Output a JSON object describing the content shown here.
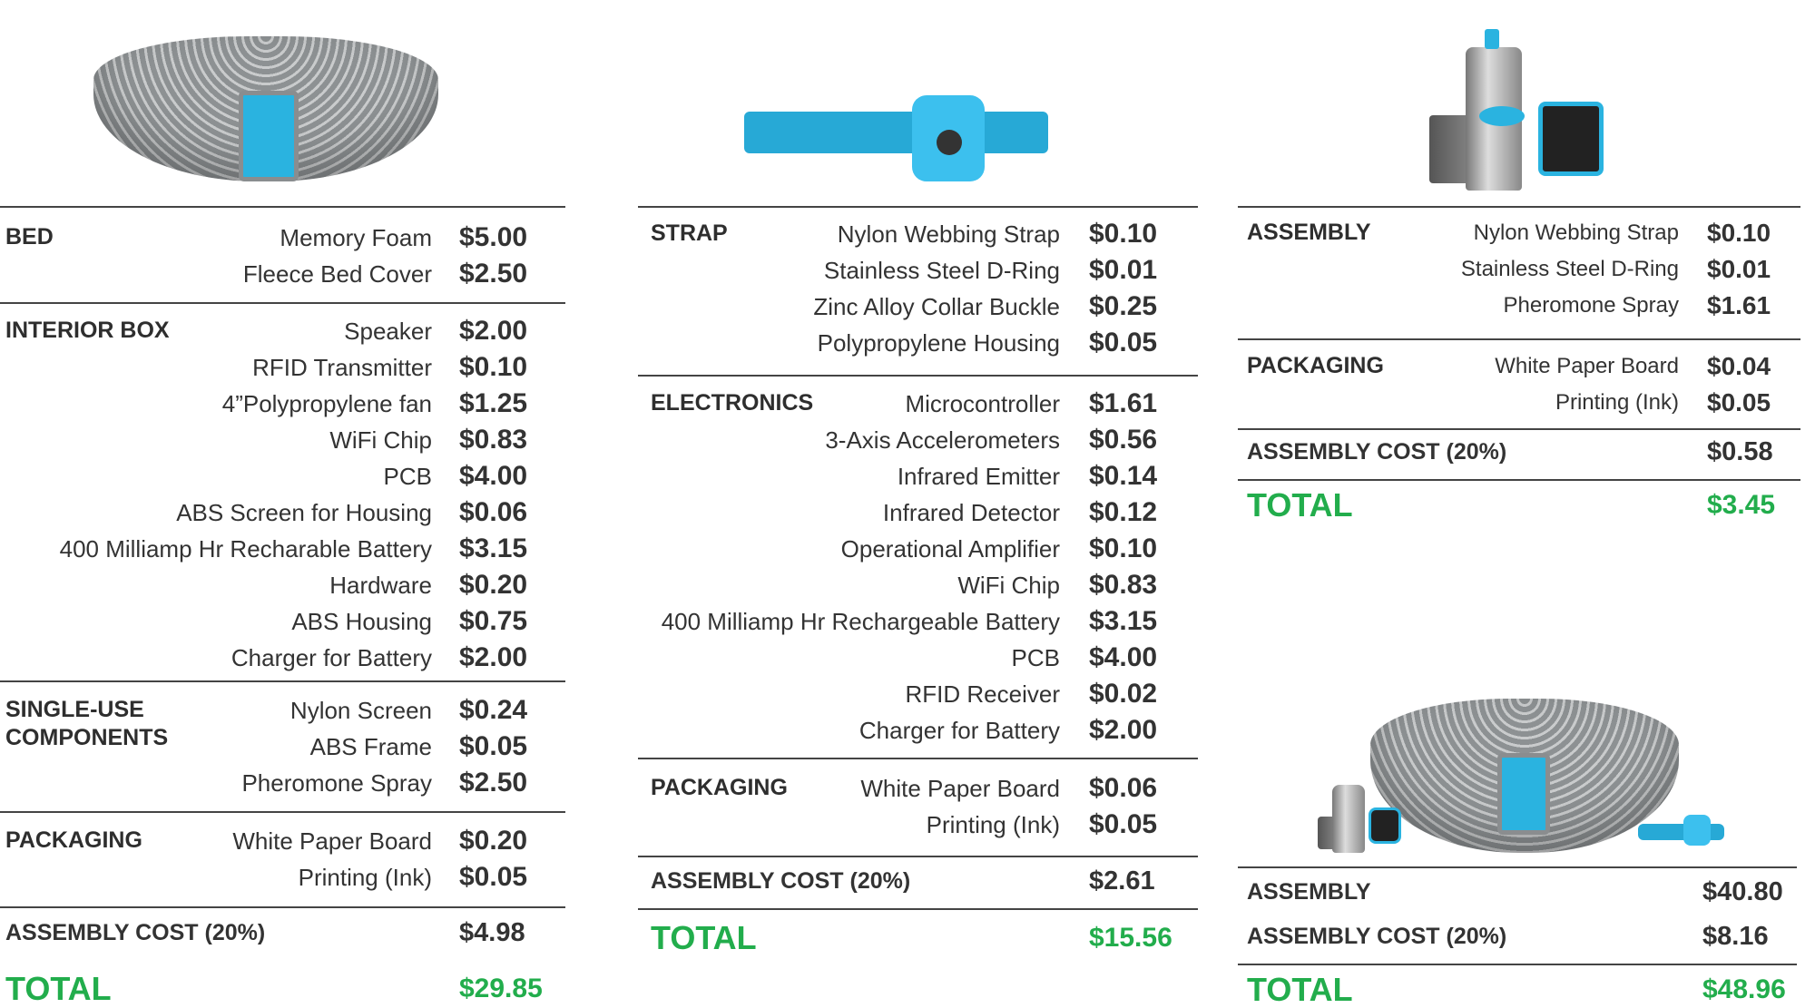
{
  "bed_column": {
    "sections": [
      {
        "label": "BED",
        "items": [
          {
            "name": "Memory Foam",
            "price": "$5.00"
          },
          {
            "name": "Fleece Bed Cover",
            "price": "$2.50"
          }
        ]
      },
      {
        "label": "INTERIOR BOX",
        "items": [
          {
            "name": "Speaker",
            "price": "$2.00"
          },
          {
            "name": "RFID Transmitter",
            "price": "$0.10"
          },
          {
            "name": "4”Polypropylene fan",
            "price": "$1.25"
          },
          {
            "name": "WiFi Chip",
            "price": "$0.83"
          },
          {
            "name": "PCB",
            "price": "$4.00"
          },
          {
            "name": "ABS Screen for Housing",
            "price": "$0.06"
          },
          {
            "name": "400 Milliamp Hr Recharable Battery",
            "price": "$3.15"
          },
          {
            "name": "Hardware",
            "price": "$0.20"
          },
          {
            "name": "ABS Housing",
            "price": "$0.75"
          },
          {
            "name": "Charger for Battery",
            "price": "$2.00"
          }
        ]
      },
      {
        "label": "SINGLE-USE COMPONENTS",
        "items": [
          {
            "name": "Nylon Screen",
            "price": "$0.24"
          },
          {
            "name": "ABS Frame",
            "price": "$0.05"
          },
          {
            "name": "Pheromone Spray",
            "price": "$2.50"
          }
        ]
      },
      {
        "label": "PACKAGING",
        "items": [
          {
            "name": "White Paper Board",
            "price": "$0.20"
          },
          {
            "name": "Printing (Ink)",
            "price": "$0.05"
          }
        ]
      }
    ],
    "assembly_cost": {
      "label": "ASSEMBLY COST (20%)",
      "price": "$4.98"
    },
    "total": {
      "label": "TOTAL",
      "price": "$29.85"
    }
  },
  "collar_column": {
    "sections": [
      {
        "label": "STRAP",
        "items": [
          {
            "name": "Nylon Webbing Strap",
            "price": "$0.10"
          },
          {
            "name": "Stainless Steel D-Ring",
            "price": "$0.01"
          },
          {
            "name": "Zinc Alloy Collar Buckle",
            "price": "$0.25"
          },
          {
            "name": "Polypropylene Housing",
            "price": "$0.05"
          }
        ]
      },
      {
        "label": "ELECTRONICS",
        "items": [
          {
            "name": "Microcontroller",
            "price": "$1.61"
          },
          {
            "name": "3-Axis Accelerometers",
            "price": "$0.56"
          },
          {
            "name": "Infrared Emitter",
            "price": "$0.14"
          },
          {
            "name": "Infrared Detector",
            "price": "$0.12"
          },
          {
            "name": "Operational Amplifier",
            "price": "$0.10"
          },
          {
            "name": "WiFi Chip",
            "price": "$0.83"
          },
          {
            "name": "400 Milliamp Hr Rechargeable Battery",
            "price": "$3.15"
          },
          {
            "name": "PCB",
            "price": "$4.00"
          },
          {
            "name": "RFID Receiver",
            "price": "$0.02"
          },
          {
            "name": "Charger for Battery",
            "price": "$2.00"
          }
        ]
      },
      {
        "label": "PACKAGING",
        "items": [
          {
            "name": "White Paper Board",
            "price": "$0.06"
          },
          {
            "name": "Printing (Ink)",
            "price": "$0.05"
          }
        ]
      }
    ],
    "assembly_cost": {
      "label": "ASSEMBLY COST (20%)",
      "price": "$2.61"
    },
    "total": {
      "label": "TOTAL",
      "price": "$15.56"
    }
  },
  "spray_column": {
    "sections": [
      {
        "label": "ASSEMBLY",
        "items": [
          {
            "name": "Nylon Webbing Strap",
            "price": "$0.10"
          },
          {
            "name": "Stainless Steel D-Ring",
            "price": "$0.01"
          },
          {
            "name": "Pheromone Spray",
            "price": "$1.61"
          }
        ]
      },
      {
        "label": "PACKAGING",
        "items": [
          {
            "name": "White Paper Board",
            "price": "$0.04"
          },
          {
            "name": "Printing (Ink)",
            "price": "$0.05"
          }
        ]
      }
    ],
    "assembly_cost": {
      "label": "ASSEMBLY COST (20%)",
      "price": "$0.58"
    },
    "total": {
      "label": "TOTAL",
      "price": "$3.45"
    }
  },
  "summary": {
    "assembly": {
      "label": "ASSEMBLY",
      "price": "$40.80"
    },
    "assembly_cost": {
      "label": "ASSEMBLY COST (20%)",
      "price": "$8.16"
    },
    "total": {
      "label": "TOTAL",
      "price": "$48.96"
    }
  },
  "colors": {
    "text": "#333333",
    "total": "#22ad4c",
    "accent": "#2ab3e0"
  }
}
